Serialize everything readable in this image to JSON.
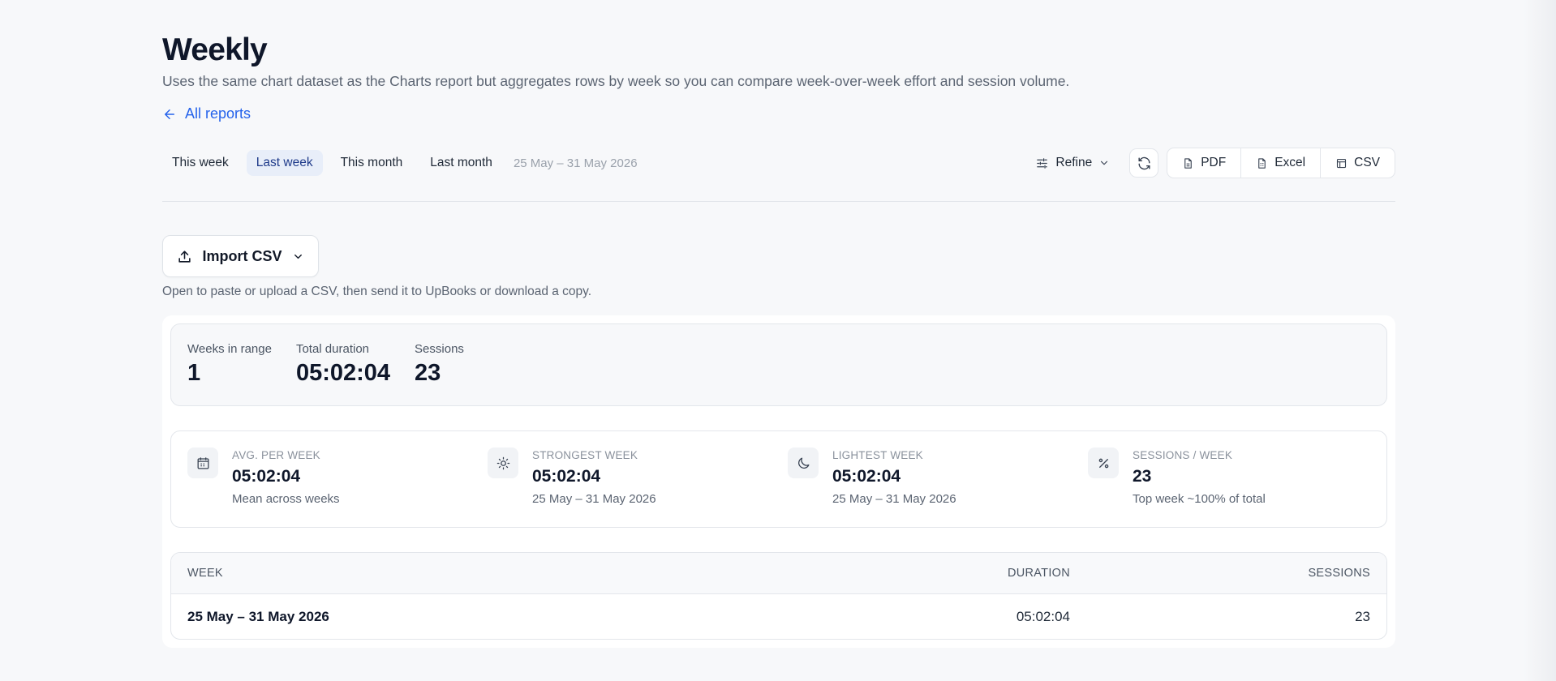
{
  "page": {
    "title": "Weekly",
    "subtitle": "Uses the same chart dataset as the Charts report but aggregates rows by week so you can compare week-over-week effort and session volume.",
    "back_link": "All reports"
  },
  "toolbar": {
    "ranges": [
      "This week",
      "Last week",
      "This month",
      "Last month"
    ],
    "active_range": "Last week",
    "range_label": "25 May – 31 May 2026",
    "refine_label": "Refine",
    "exports": [
      "PDF",
      "Excel",
      "CSV"
    ]
  },
  "import": {
    "button_label": "Import CSV",
    "help_text": "Open to paste or upload a CSV, then send it to UpBooks or download a copy."
  },
  "summary": [
    {
      "label": "Weeks in range",
      "value": "1"
    },
    {
      "label": "Total duration",
      "value": "05:02:04"
    },
    {
      "label": "Sessions",
      "value": "23"
    }
  ],
  "stats": [
    {
      "icon": "calendar-icon",
      "label": "AVG. PER WEEK",
      "value": "05:02:04",
      "sub": "Mean across weeks"
    },
    {
      "icon": "sun-icon",
      "label": "STRONGEST WEEK",
      "value": "05:02:04",
      "sub": "25 May – 31 May 2026"
    },
    {
      "icon": "moon-icon",
      "label": "LIGHTEST WEEK",
      "value": "05:02:04",
      "sub": "25 May – 31 May 2026"
    },
    {
      "icon": "percent-icon",
      "label": "SESSIONS / WEEK",
      "value": "23",
      "sub": "Top week ~100% of total"
    }
  ],
  "table": {
    "headers": {
      "week": "WEEK",
      "duration": "DURATION",
      "sessions": "SESSIONS"
    },
    "rows": [
      {
        "week": "25 May – 31 May 2026",
        "duration": "05:02:04",
        "sessions": "23"
      }
    ]
  }
}
